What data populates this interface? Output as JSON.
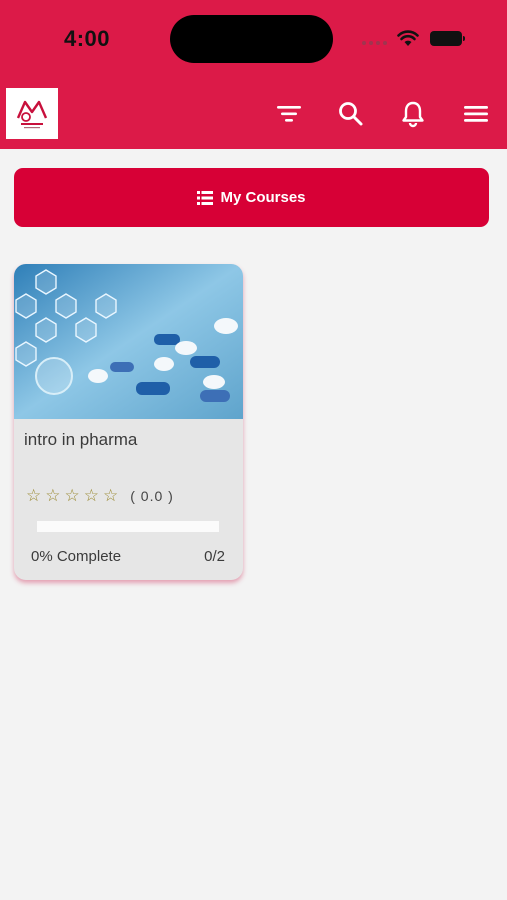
{
  "status_bar": {
    "time": "4:00"
  },
  "header": {
    "logo": "app-logo",
    "icons": [
      "filter-icon",
      "search-icon",
      "bell-icon",
      "menu-icon"
    ],
    "color": "#dc1a48"
  },
  "section_button": {
    "label": "My Courses",
    "icon": "list-icon",
    "color": "#d70036"
  },
  "courses": [
    {
      "title": "intro in pharma",
      "rating": 0,
      "rating_text": "( 0.0 )",
      "stars": 5,
      "progress": 0,
      "complete_text": "0% Complete",
      "lessons_text": "0/2"
    }
  ]
}
